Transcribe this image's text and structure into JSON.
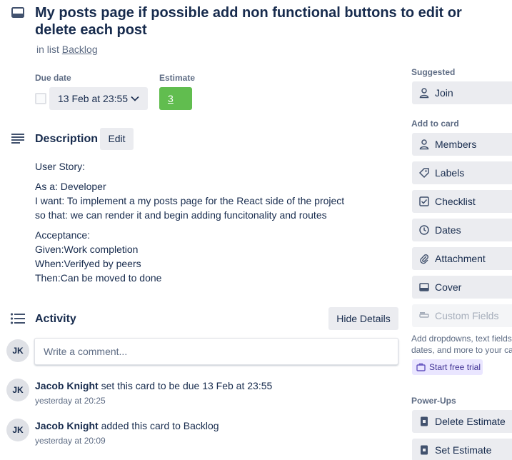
{
  "card": {
    "title": "My posts page if possible add non functional buttons to edit or delete each post",
    "in_list_prefix": "in list",
    "list_name": "Backlog"
  },
  "due": {
    "label": "Due date",
    "value": "13 Feb at 23:55",
    "checked": false
  },
  "estimate": {
    "label": "Estimate",
    "value": "3",
    "color": "#61bd4f"
  },
  "description": {
    "title": "Description",
    "edit_label": "Edit",
    "lines": [
      "User Story:",
      "As a: Developer",
      "I want: To implement a my posts page for the React side of the project",
      "so that: we can render it and begin adding funcitonality and routes",
      "Acceptance:",
      "Given:Work completion",
      "When:Verifyed by peers",
      "Then:Can be moved to done"
    ]
  },
  "activity": {
    "title": "Activity",
    "toggle_label": "Hide Details",
    "comment_placeholder": "Write a comment...",
    "user_initials": "JK",
    "entries": [
      {
        "initials": "JK",
        "user": "Jacob Knight",
        "action": "set this card to be due 13 Feb at 23:55",
        "time": "yesterday at 20:25"
      },
      {
        "initials": "JK",
        "user": "Jacob Knight",
        "action": "added this card to Backlog",
        "time": "yesterday at 20:09"
      }
    ]
  },
  "sidebar": {
    "suggested_title": "Suggested",
    "join_label": "Join",
    "add_to_card_title": "Add to card",
    "add_items": [
      {
        "label": "Members",
        "icon": "person-icon"
      },
      {
        "label": "Labels",
        "icon": "tag-icon"
      },
      {
        "label": "Checklist",
        "icon": "checkbox-icon"
      },
      {
        "label": "Dates",
        "icon": "clock-icon"
      },
      {
        "label": "Attachment",
        "icon": "paperclip-icon"
      },
      {
        "label": "Cover",
        "icon": "cover-icon"
      },
      {
        "label": "Custom Fields",
        "icon": "custom-fields-icon",
        "disabled": true
      }
    ],
    "custom_fields_note": [
      "Add dropdowns, text fields,",
      "dates, and more to your ca"
    ],
    "trial_label": "Start free trial",
    "powerups_title": "Power-Ups",
    "powerups": [
      {
        "label": "Delete Estimate",
        "icon": "estimate-icon"
      },
      {
        "label": "Set Estimate",
        "icon": "estimate-icon"
      }
    ]
  },
  "colors": {
    "text": "#172b4d",
    "muted": "#5e6c84",
    "button_bg": "#ebecf0",
    "accent_green": "#61bd4f",
    "trial_bg": "#eae6ff"
  }
}
